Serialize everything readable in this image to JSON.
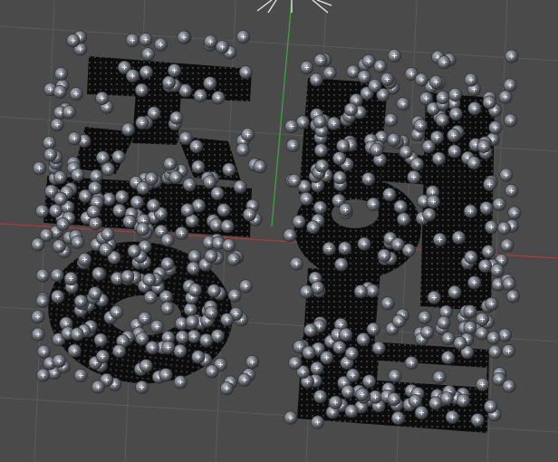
{
  "viewport": {
    "background": "#4a4a4a",
    "grid_color": "#5a5a5a",
    "axis_x_color": "#b03a3a",
    "axis_y_color": "#3fa83f",
    "glyph_color": "#0c0c0c",
    "particle_color": "#7c8088",
    "particle_marker": "+",
    "light_gizmo_icon": "sun-light-icon"
  }
}
